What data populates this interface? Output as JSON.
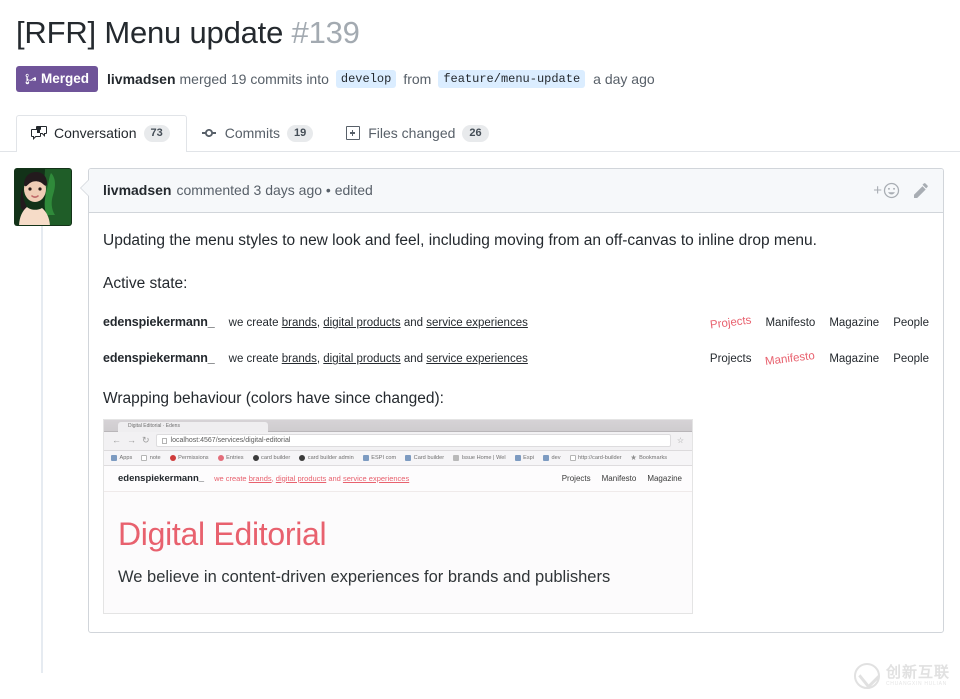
{
  "header": {
    "title": "[RFR] Menu update",
    "number": "#139",
    "state": "Merged",
    "author": "livmadsen",
    "merged_text": "merged 19 commits into",
    "base_branch": "develop",
    "from_text": "from",
    "head_branch": "feature/menu-update",
    "timestamp": "a day ago",
    "state_color": "#6f5499"
  },
  "tabs": [
    {
      "label": "Conversation",
      "count": "73",
      "icon": "comment-discussion-icon",
      "active": true
    },
    {
      "label": "Commits",
      "count": "19",
      "icon": "git-commit-icon",
      "active": false
    },
    {
      "label": "Files changed",
      "count": "26",
      "icon": "diff-file-icon",
      "active": false
    }
  ],
  "comment": {
    "author": "livmadsen",
    "meta": "commented 3 days ago • edited",
    "actions": {
      "add_reaction": "add-reaction",
      "edit": "edit-comment"
    },
    "body": {
      "paragraph_1": "Updating the menu styles to new look and feel, including moving from an off-canvas to inline drop menu.",
      "paragraph_2": "Active state:",
      "paragraph_3": "Wrapping behaviour (colors have since changed):"
    }
  },
  "menu_mocks": [
    {
      "brand": "edenspiekermann_",
      "tagline_prefix": "we create ",
      "tagline_link_1": "brands",
      "tagline_sep_1": ", ",
      "tagline_link_2": "digital products",
      "tagline_mid": " and ",
      "tagline_link_3": "service experiences",
      "nav": [
        {
          "label": "Projects",
          "active": true
        },
        {
          "label": "Manifesto",
          "active": false
        },
        {
          "label": "Magazine",
          "active": false
        },
        {
          "label": "People",
          "active": false
        }
      ]
    },
    {
      "brand": "edenspiekermann_",
      "tagline_prefix": "we create ",
      "tagline_link_1": "brands",
      "tagline_sep_1": ", ",
      "tagline_link_2": "digital products",
      "tagline_mid": " and ",
      "tagline_link_3": "service experiences",
      "nav": [
        {
          "label": "Projects",
          "active": false
        },
        {
          "label": "Manifesto",
          "active": true
        },
        {
          "label": "Magazine",
          "active": false
        },
        {
          "label": "People",
          "active": false
        }
      ]
    }
  ],
  "browser_shot": {
    "tab_title": "Digital Editorial · Edens",
    "back_icon": "back-arrow-icon",
    "forward_icon": "forward-arrow-icon",
    "reload_icon": "reload-icon",
    "url": "localhost:4567/services/digital-editorial",
    "star_icon": "star-icon",
    "bookmarks": [
      {
        "label": "Apps",
        "icon": "apps-icon",
        "color": "blue"
      },
      {
        "label": "note",
        "icon": "page-icon",
        "color": "page"
      },
      {
        "label": "Permissions",
        "icon": "favicon",
        "color": "red"
      },
      {
        "label": "Entries",
        "icon": "favicon",
        "color": "pink"
      },
      {
        "label": "card builder",
        "icon": "github-icon",
        "color": "dark"
      },
      {
        "label": "card builder admin",
        "icon": "github-icon",
        "color": "dark"
      },
      {
        "label": "ESPI com",
        "icon": "apps-icon",
        "color": "blue"
      },
      {
        "label": "Card builder",
        "icon": "apps-icon",
        "color": "blue"
      },
      {
        "label": "Issue Home | Wel",
        "icon": "favicon",
        "color": "default"
      },
      {
        "label": "Espi",
        "icon": "apps-icon",
        "color": "blue"
      },
      {
        "label": "dev",
        "icon": "apps-icon",
        "color": "blue"
      },
      {
        "label": "http://card-builder",
        "icon": "page-icon",
        "color": "page"
      },
      {
        "label": "Bookmarks",
        "icon": "star-icon",
        "color": "star"
      }
    ],
    "site": {
      "brand": "edenspiekermann_",
      "tagline_prefix": "we create ",
      "tagline_link_1": "brands",
      "tagline_sep_1": ", ",
      "tagline_link_2": "digital products",
      "tagline_mid": " and ",
      "tagline_link_3": "service experiences",
      "nav": [
        {
          "label": "Projects"
        },
        {
          "label": "Manifesto"
        },
        {
          "label": "Magazine"
        }
      ],
      "headline": "Digital Editorial",
      "subhead": "We believe in content-driven experiences for brands and publishers",
      "accent_color": "#e8616e"
    }
  },
  "watermark": {
    "cn": "创新互联",
    "en": "CHUANGXIN HULIAN"
  }
}
